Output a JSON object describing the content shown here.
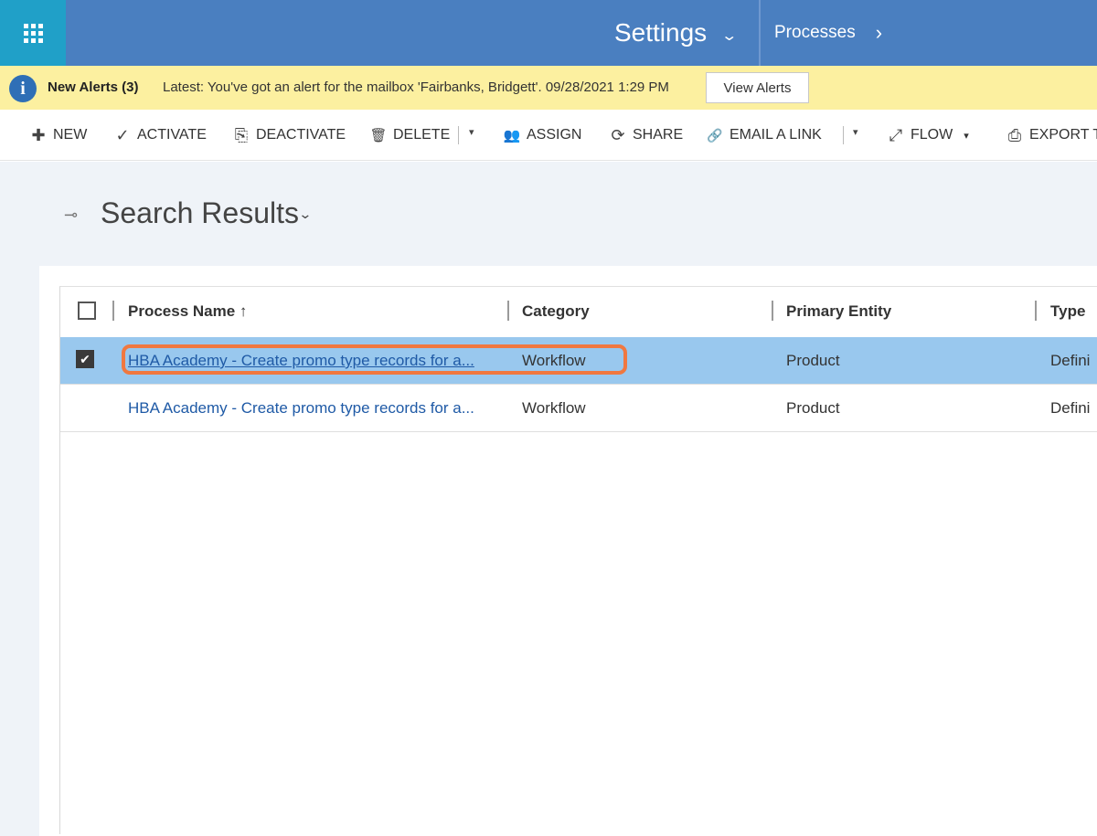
{
  "topbar": {
    "app_icon": "waffle-grid-icon",
    "settings_label": "Settings",
    "settings_chevron": "⌄",
    "processes_label": "Processes",
    "processes_chevron": "›",
    "color": "#4a7fc0",
    "waffle_color": "#20a0c8"
  },
  "alerts": {
    "icon": "info-icon",
    "icon_glyph": "i",
    "title": "New Alerts (3)",
    "message": "Latest: You've got an alert for the mailbox 'Fairbanks, Bridgett'. 09/28/2021 1:29 PM",
    "view_button": "View Alerts",
    "background": "#fcf0a0"
  },
  "commands": {
    "new": {
      "icon": "plus-icon",
      "glyph": "✚",
      "label": "NEW"
    },
    "activate": {
      "icon": "check-icon",
      "glyph": "✓",
      "label": "ACTIVATE"
    },
    "deactivate": {
      "icon": "deactivate-icon",
      "glyph": "⎘",
      "label": "DEACTIVATE"
    },
    "delete": {
      "icon": "trash-icon",
      "glyph": "🗑",
      "label": "DELETE"
    },
    "assign": {
      "icon": "assign-icon",
      "glyph": "👥",
      "label": "ASSIGN"
    },
    "share": {
      "icon": "share-icon",
      "glyph": "⟳",
      "label": "SHARE"
    },
    "email_link": {
      "icon": "link-icon",
      "glyph": "🔗",
      "label": "EMAIL A LINK"
    },
    "flow": {
      "icon": "flow-icon",
      "glyph": "⤢",
      "label": "FLOW"
    },
    "export": {
      "icon": "excel-icon",
      "glyph": "⎙",
      "label": "EXPORT T"
    },
    "caret": "▾"
  },
  "view": {
    "pin_glyph": "⊸",
    "title": "Search Results",
    "chevron": "⌄"
  },
  "grid": {
    "columns": [
      {
        "label": "Process Name ↑"
      },
      {
        "label": "Category"
      },
      {
        "label": "Primary Entity"
      },
      {
        "label": "Type"
      }
    ],
    "rows": [
      {
        "selected": true,
        "process_name": "HBA Academy - Create promo type records for a...",
        "category": "Workflow",
        "primary_entity": "Product",
        "type": "Defini"
      },
      {
        "selected": false,
        "process_name": "HBA Academy - Create promo type records for a...",
        "category": "Workflow",
        "primary_entity": "Product",
        "type": "Defini"
      }
    ],
    "check_glyph": "✔",
    "selected_row_color": "#99c8ee",
    "highlight_color": "#f07840"
  }
}
